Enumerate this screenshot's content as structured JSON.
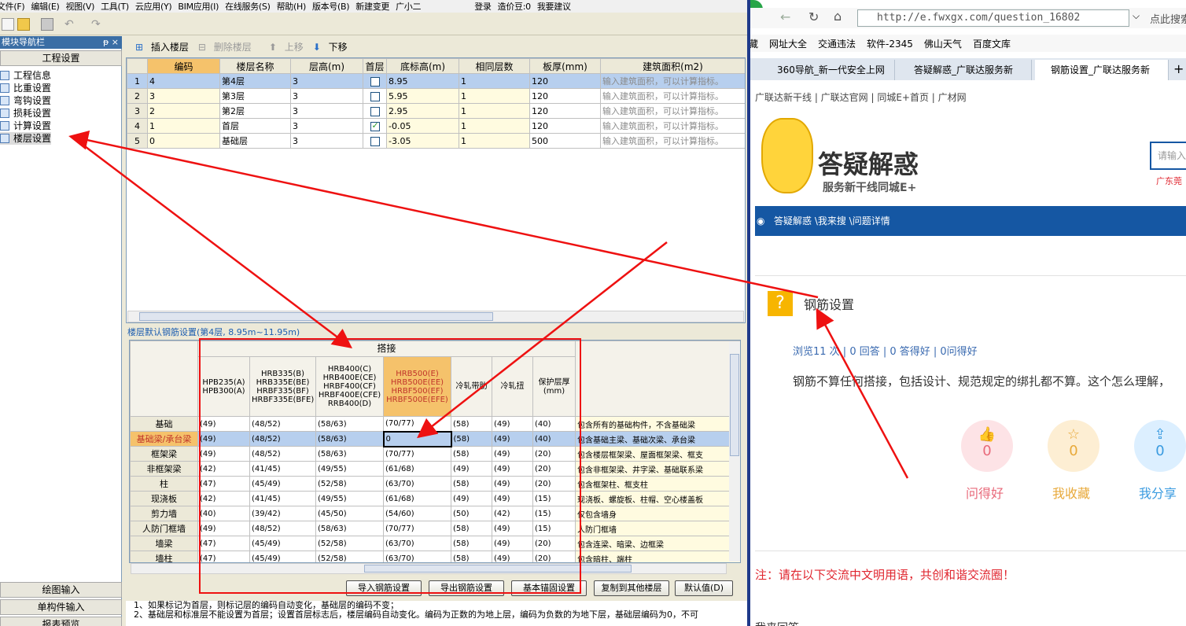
{
  "menubar": [
    "文件(F)",
    "编辑(E)",
    "视图(V)",
    "工具(T)",
    "云应用(Y)",
    "BIM应用(I)",
    "在线服务(S)",
    "帮助(H)",
    "版本号(B)",
    "新建变更",
    "广小二",
    "登录",
    "造价豆:0",
    "我要建议"
  ],
  "sidebar": {
    "title": "模块导航栏",
    "pin": "ᵽ ×",
    "section": "工程设置",
    "items": [
      "工程信息",
      "比重设置",
      "弯钩设置",
      "损耗设置",
      "计算设置",
      "楼层设置"
    ],
    "bottom_buttons": [
      "绘图输入",
      "单构件输入",
      "报表预览"
    ]
  },
  "floor_toolbar": {
    "insert": "插入楼层",
    "delete": "删除楼层",
    "up": "上移",
    "down": "下移"
  },
  "floor_table": {
    "headers": [
      "编码",
      "楼层名称",
      "层高(m)",
      "首层",
      "底标高(m)",
      "相同层数",
      "板厚(mm)",
      "建筑面积(m2)"
    ],
    "rows": [
      {
        "no": "1",
        "code": "4",
        "name": "第4层",
        "height": "3",
        "first": false,
        "base": "8.95",
        "same": "1",
        "thick": "120",
        "area": "输入建筑面积，可以计算指标。"
      },
      {
        "no": "2",
        "code": "3",
        "name": "第3层",
        "height": "3",
        "first": false,
        "base": "5.95",
        "same": "1",
        "thick": "120",
        "area": "输入建筑面积，可以计算指标。"
      },
      {
        "no": "3",
        "code": "2",
        "name": "第2层",
        "height": "3",
        "first": false,
        "base": "2.95",
        "same": "1",
        "thick": "120",
        "area": "输入建筑面积，可以计算指标。"
      },
      {
        "no": "4",
        "code": "1",
        "name": "首层",
        "height": "3",
        "first": true,
        "base": "-0.05",
        "same": "1",
        "thick": "120",
        "area": "输入建筑面积，可以计算指标。"
      },
      {
        "no": "5",
        "code": "0",
        "name": "基础层",
        "height": "3",
        "first": false,
        "base": "-3.05",
        "same": "1",
        "thick": "500",
        "area": "输入建筑面积，可以计算指标。"
      }
    ]
  },
  "rebar": {
    "title": "楼层默认钢筋设置(第4层, 8.95m~11.95m)",
    "group_header": "搭接",
    "headers": [
      "HPB235(A)\nHPB300(A)",
      "HRB335(B)\nHRB335E(BE)\nHRBF335(BF)\nHRBF335E(BFE)",
      "HRB400(C)\nHRB400E(CE)\nHRBF400(CF)\nHRBF400E(CFE)\nRRB400(D)",
      "HRB500(E)\nHRB500E(EE)\nHRBF500(EF)\nHRBF500E(EFE)",
      "冷轧带肋",
      "冷轧扭",
      "保护层厚\n(mm)",
      "备"
    ],
    "rows": [
      {
        "name": "基础",
        "v": [
          "(49)",
          "(48/52)",
          "(58/63)",
          "(70/77)",
          "(58)",
          "(49)",
          "(40)",
          "包含所有的基础构件，不含基础梁"
        ]
      },
      {
        "name": "基础梁/承台梁",
        "v": [
          "(49)",
          "(48/52)",
          "(58/63)",
          "0",
          "(58)",
          "(49)",
          "(40)",
          "包含基础主梁、基础次梁、承台梁"
        ]
      },
      {
        "name": "框架梁",
        "v": [
          "(49)",
          "(48/52)",
          "(58/63)",
          "(70/77)",
          "(58)",
          "(49)",
          "(20)",
          "包含楼层框架梁、屋面框架梁、框支"
        ]
      },
      {
        "name": "非框架梁",
        "v": [
          "(42)",
          "(41/45)",
          "(49/55)",
          "(61/68)",
          "(49)",
          "(49)",
          "(20)",
          "包含非框架梁、井字梁、基础联系梁"
        ]
      },
      {
        "name": "柱",
        "v": [
          "(47)",
          "(45/49)",
          "(52/58)",
          "(63/70)",
          "(58)",
          "(49)",
          "(20)",
          "包含框架柱、框支柱"
        ]
      },
      {
        "name": "现浇板",
        "v": [
          "(42)",
          "(41/45)",
          "(49/55)",
          "(61/68)",
          "(49)",
          "(49)",
          "(15)",
          "现浇板、螺旋板、柱帽、空心楼盖板"
        ]
      },
      {
        "name": "剪力墙",
        "v": [
          "(40)",
          "(39/42)",
          "(45/50)",
          "(54/60)",
          "(50)",
          "(42)",
          "(15)",
          "仅包含墙身"
        ]
      },
      {
        "name": "人防门框墙",
        "v": [
          "(49)",
          "(48/52)",
          "(58/63)",
          "(70/77)",
          "(58)",
          "(49)",
          "(15)",
          "人防门框墙"
        ]
      },
      {
        "name": "墙梁",
        "v": [
          "(47)",
          "(45/49)",
          "(52/58)",
          "(63/70)",
          "(58)",
          "(49)",
          "(20)",
          "包含连梁、暗梁、边框梁"
        ]
      },
      {
        "name": "墙柱",
        "v": [
          "(47)",
          "(45/49)",
          "(52/58)",
          "(63/70)",
          "(58)",
          "(49)",
          "(20)",
          "包含暗柱、端柱"
        ]
      }
    ]
  },
  "buttons": [
    "导入钢筋设置",
    "导出钢筋设置",
    "基本锚固设置",
    "复制到其他楼层",
    "默认值(D)"
  ],
  "notes": [
    "1、如果标记为首层，则标记层的编码自动变化，基础层的编码不变；",
    "2、基础层和标准层不能设置为首层；设置首层标志后，楼层编码自动变化。编码为正数的为地上层，编码为负数的为地下层，基础层编码为0，不可"
  ],
  "browser": {
    "url": "http://e.fwxgx.com/question_16802",
    "search_btn": "点此搜索",
    "favorites": [
      "藏",
      "网址大全",
      "交通违法",
      "软件-2345",
      "佛山天气",
      "百度文库"
    ],
    "tabs": [
      "360导航_新一代安全上网",
      "答疑解惑_广联达服务新",
      "钢筋设置_广联达服务新"
    ],
    "site_nav": "广联达新干线  |  广联达官网  |  同城E+首页  |  广材网",
    "logo_title": "答疑解惑",
    "logo_sub": "服务新干线同城E+",
    "search_placeholder": "请输入",
    "region": "广东莞",
    "breadcrumb": "答疑解惑 \\我来搜 \\问题详情",
    "question_title": "钢筋设置",
    "stats": "浏览11 次 | 0 回答 | 0 答得好 | 0问得好",
    "question_body": "钢筋不算任何搭接，包括设计、规范规定的绑扎都不算。这个怎么理解，",
    "actions": [
      {
        "label": "问得好",
        "count": "0",
        "color": "#e8697a",
        "bg": "#fde3e6"
      },
      {
        "label": "我收藏",
        "count": "0",
        "color": "#e8a93a",
        "bg": "#fdeed3"
      },
      {
        "label": "我分享",
        "count": "0",
        "color": "#3a9be0",
        "bg": "#dcefff"
      }
    ],
    "notice": "注：请在以下交流中文明用语，共创和谐交流圈！",
    "bottom_cut": "我来回答"
  },
  "colors": {
    "annotation": "#e11",
    "selection": "#b7cfee",
    "highlight": "#f5c26b",
    "nav_blue": "#1557a3"
  }
}
